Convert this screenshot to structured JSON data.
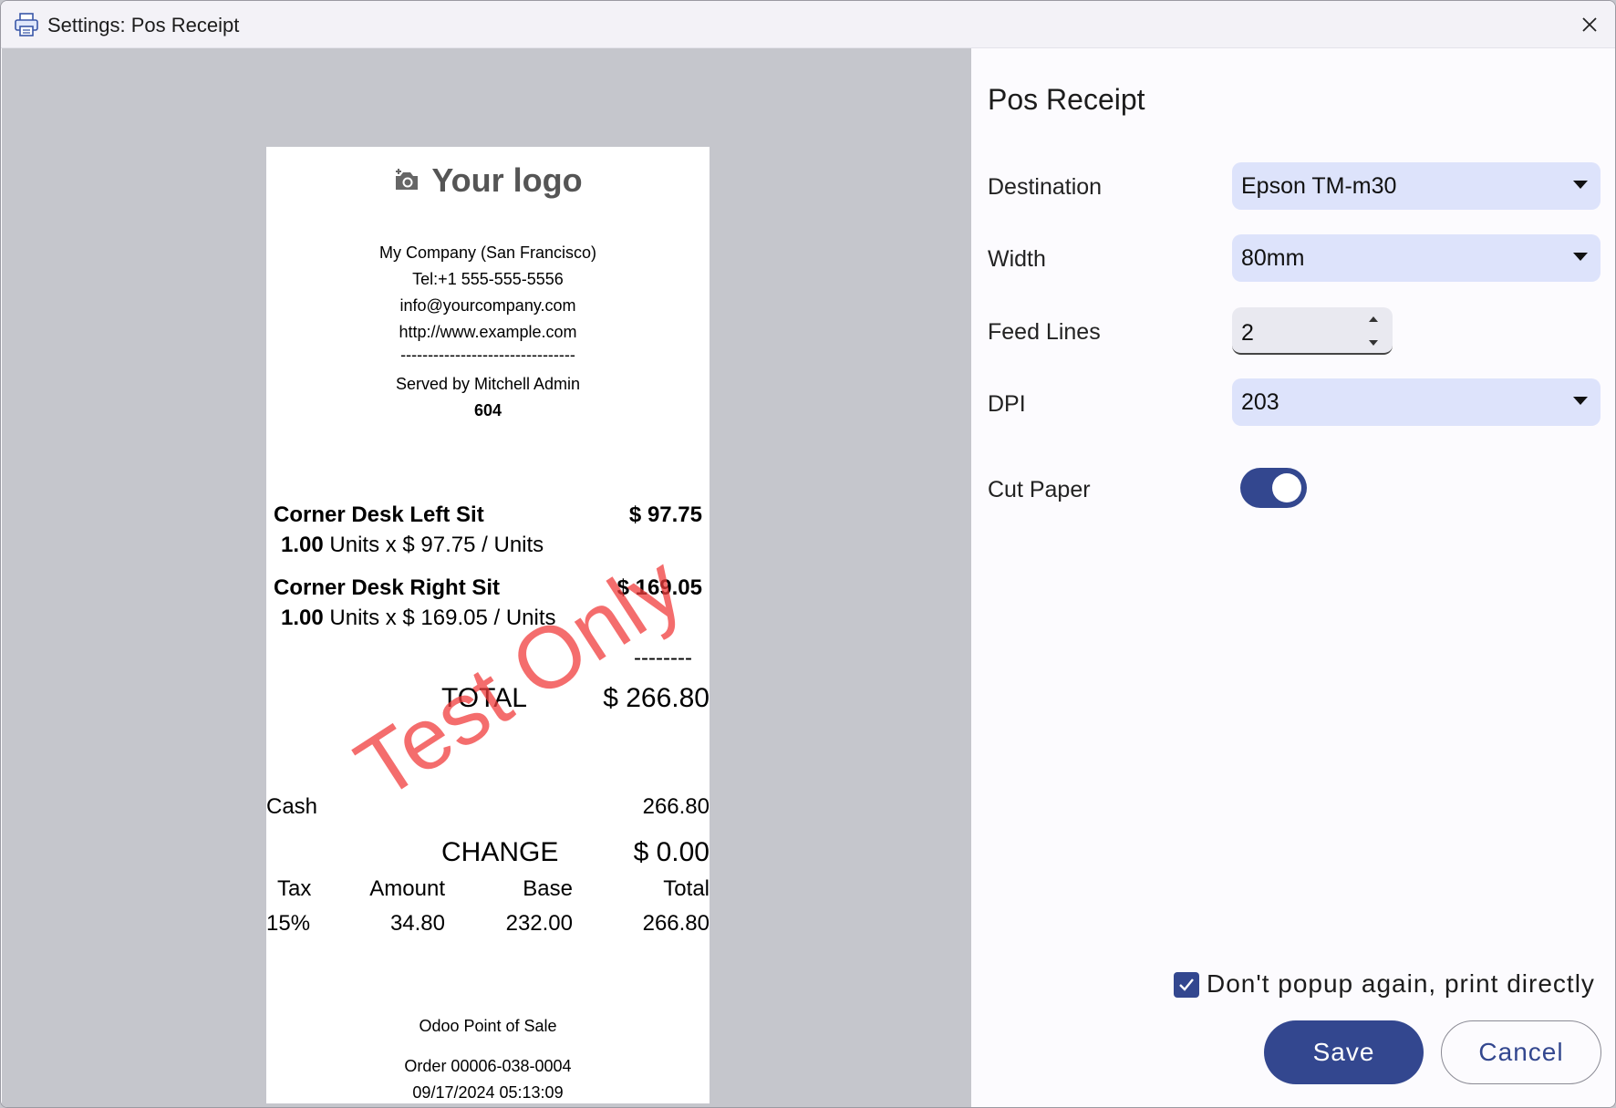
{
  "window": {
    "title": "Settings: Pos Receipt"
  },
  "receipt": {
    "logo_text": "Your logo",
    "company": "My Company (San Francisco)",
    "tel": "Tel:+1 555-555-5556",
    "email": "info@yourcompany.com",
    "website": "http://www.example.com",
    "divider": "--------------------------------",
    "served_by": "Served by Mitchell Admin",
    "order_number": "604",
    "lines": [
      {
        "name": "Corner Desk Left Sit",
        "price": "$ 97.75",
        "qty": "1.00",
        "detail": "Units x $ 97.75 / Units"
      },
      {
        "name": "Corner Desk Right Sit",
        "price": "$ 169.05",
        "qty": "1.00",
        "detail": "Units x $ 169.05 / Units"
      }
    ],
    "total_divider": "--------",
    "total_label": "TOTAL",
    "total_value": "$ 266.80",
    "payment_label": "Cash",
    "payment_value": "266.80",
    "change_label": "CHANGE",
    "change_value": "$ 0.00",
    "tax_headers": [
      "Tax",
      "Amount",
      "Base",
      "Total"
    ],
    "tax_row": [
      "15%",
      "34.80",
      "232.00",
      "266.80"
    ],
    "footer": "Odoo Point of Sale",
    "order_ref": "Order 00006-038-0004",
    "datetime": "09/17/2024 05:13:09",
    "watermark": "Test Only"
  },
  "settings": {
    "heading": "Pos Receipt",
    "destination": {
      "label": "Destination",
      "value": "Epson TM-m30"
    },
    "width": {
      "label": "Width",
      "value": "80mm"
    },
    "feed_lines": {
      "label": "Feed Lines",
      "value": "2"
    },
    "dpi": {
      "label": "DPI",
      "value": "203"
    },
    "cut_paper": {
      "label": "Cut Paper",
      "on": true
    },
    "dont_popup": {
      "label": "Don't popup again, print directly",
      "checked": true
    },
    "save_label": "Save",
    "cancel_label": "Cancel"
  },
  "colors": {
    "accent": "#33478f",
    "select_bg": "#dde3fb",
    "preview_bg": "#c5c6cc",
    "watermark": "#f03c3c"
  }
}
